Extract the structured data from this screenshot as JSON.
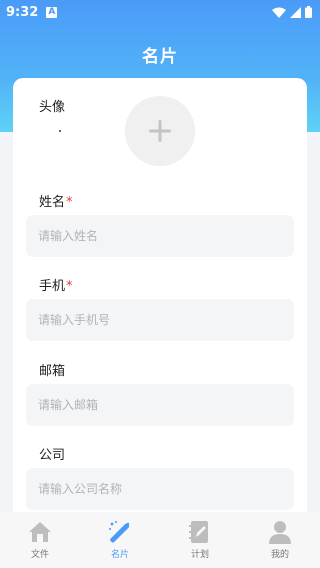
{
  "status_bar": {
    "time": "9:32",
    "notification_badge": "A"
  },
  "header": {
    "title": "名片"
  },
  "form": {
    "avatar_label": "头像",
    "fields": [
      {
        "label": "姓名",
        "required_mark": "*",
        "placeholder": "请输入姓名",
        "value": ""
      },
      {
        "label": "手机",
        "required_mark": "*",
        "placeholder": "请输入手机号",
        "value": ""
      },
      {
        "label": "邮箱",
        "placeholder": "请输入邮箱",
        "value": ""
      },
      {
        "label": "公司",
        "placeholder": "请输入公司名称",
        "value": ""
      }
    ]
  },
  "tab_bar": {
    "active_index": 1,
    "active_color": "#4a9bf8",
    "tabs": [
      {
        "label": "文件",
        "icon": "home-icon"
      },
      {
        "label": "名片",
        "icon": "magic-wand-icon"
      },
      {
        "label": "计划",
        "icon": "notebook-edit-icon"
      },
      {
        "label": "我的",
        "icon": "user-icon"
      }
    ]
  }
}
